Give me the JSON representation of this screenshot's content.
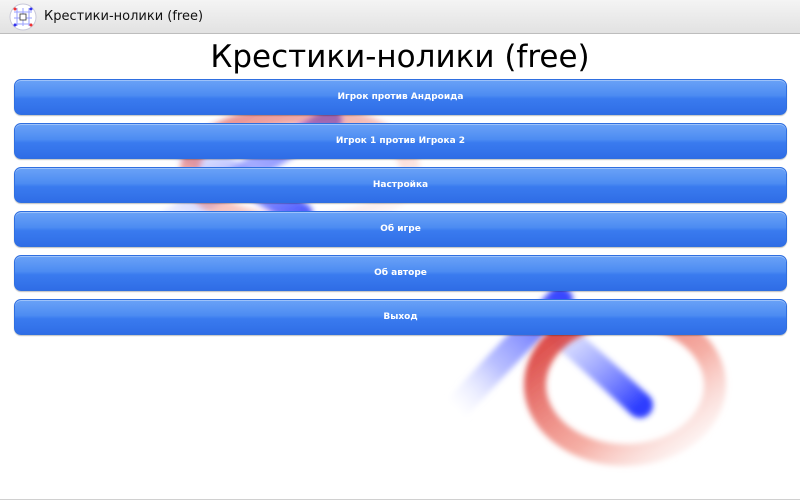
{
  "window": {
    "title": "Крестики-нолики (free)",
    "icon": "tic-tac-toe-app-icon"
  },
  "main": {
    "title": "Крестики-нолики (free)",
    "menu": [
      {
        "label": "Игрок против Андроида"
      },
      {
        "label": "Игрок 1 против Игрока 2"
      },
      {
        "label": "Настройка"
      },
      {
        "label": "Об игре"
      },
      {
        "label": "Об авторе"
      },
      {
        "label": "Выход"
      }
    ]
  },
  "colors": {
    "button": "#4a8af3",
    "cross": "#3a4cff",
    "nought": "#e23a2a"
  }
}
